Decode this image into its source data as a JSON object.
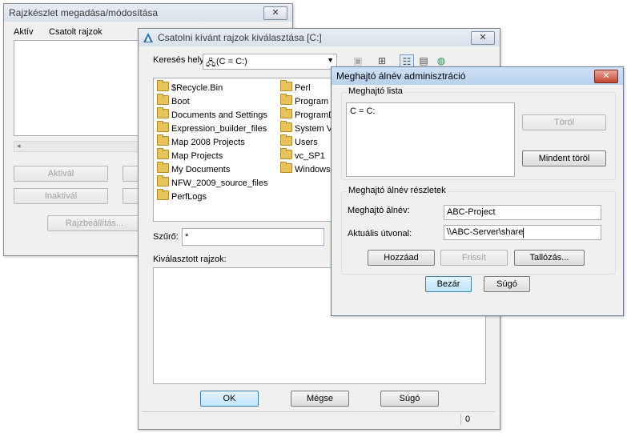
{
  "dialog1": {
    "title": "Rajzkészlet megadása/módosítása",
    "col_active": "Aktív",
    "col_drawings": "Csatolt rajzok",
    "activate": "Aktivál",
    "deactivate": "Inaktivál",
    "drawing_settings": "Rajzbeállítás..."
  },
  "dialog2": {
    "title": "Csatolni kívánt rajzok kiválasztása [C:]",
    "lookin_label": "Keresés helye:",
    "lookin_value": "(C = C:)",
    "folders_col1": [
      "$Recycle.Bin",
      "Boot",
      "Documents and Settings",
      "Expression_builder_files",
      "Map 2008 Projects",
      "Map Projects",
      "My Documents",
      "NFW_2009_source_files",
      "PerfLogs"
    ],
    "folders_col2": [
      "Perl",
      "Program F",
      "ProgramDa",
      "System Vo",
      "Users",
      "vc_SP1",
      "Windows"
    ],
    "filter_label": "Szűrő:",
    "filter_value": "*",
    "selected_label": "Kiválasztott rajzok:",
    "ok": "OK",
    "cancel": "Mégse",
    "help": "Súgó",
    "status_count": "0"
  },
  "dialog3": {
    "title": "Meghajtó álnév adminisztráció",
    "list_group": "Meghajtó lista",
    "list_items": [
      "C = C:"
    ],
    "delete": "Töröl",
    "delete_all": "Mindent töröl",
    "details_group": "Meghajtó álnév részletek",
    "alias_label": "Meghajtó álnév:",
    "alias_value": "ABC-Project",
    "path_label": "Aktuális útvonal:",
    "path_value": "\\\\ABC-Server\\share",
    "add": "Hozzáad",
    "refresh": "Frissít",
    "browse": "Tallózás...",
    "close": "Bezár",
    "help": "Súgó"
  },
  "icons": {
    "close": "close-icon",
    "folder": "folder-icon",
    "drive": "drive-icon",
    "dropdown": "chevron-down-icon"
  },
  "colors": {
    "active_title": "#b9d1ee",
    "inactive_title": "#e1e7ef",
    "close_red": "#c4452e",
    "folder": "#e8c25b"
  }
}
